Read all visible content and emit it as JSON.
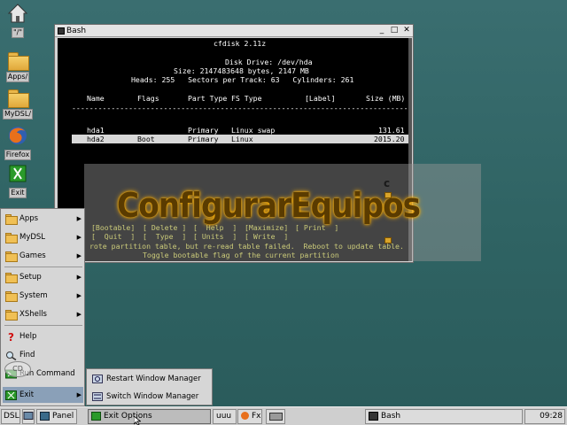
{
  "desktop": {
    "icons": [
      {
        "label": "\"/\"",
        "icon": "home-icon"
      },
      {
        "label": "Apps/",
        "icon": "folder-icon"
      },
      {
        "label": "MyDSL/",
        "icon": "folder-icon"
      },
      {
        "label": "Firefox",
        "icon": "firefox-icon"
      },
      {
        "label": "Exit",
        "icon": "exit-icon"
      }
    ]
  },
  "window": {
    "title": "Bash",
    "buttons": {
      "minimize": "_",
      "maximize": "□",
      "close": "✕"
    }
  },
  "cfdisk": {
    "title": "cfdisk 2.11z",
    "disk_drive": "Disk Drive: /dev/hda",
    "size_line": "Size: 2147483648 bytes, 2147 MB",
    "geometry": "Heads: 255   Sectors per Track: 63   Cylinders: 261",
    "columns": [
      "Name",
      "Flags",
      "Part Type",
      "FS Type",
      "[Label]",
      "Size (MB)"
    ],
    "rows": [
      {
        "name": "hda1",
        "flags": "",
        "part_type": "Primary",
        "fs_type": "Linux swap",
        "label": "",
        "size": "131.61"
      },
      {
        "name": "hda2",
        "flags": "Boot",
        "part_type": "Primary",
        "fs_type": "Linux",
        "label": "",
        "size": "2015.20"
      }
    ],
    "menu_row1": [
      "[Bootable]",
      "[ Delete ]",
      "[  Help  ]",
      "[Maximize]",
      "[ Print  ]"
    ],
    "menu_row2": [
      "[  Quit  ]",
      "[  Type  ]",
      "[ Units  ]",
      "[ Write  ]"
    ],
    "message": "rote partition table, but re-read table failed.  Reboot to update table.",
    "help_text": "Toggle bootable flag of the current partition"
  },
  "watermark": {
    "text": "ConfigurarEquipos",
    "letter": "c"
  },
  "start_menu": {
    "items": [
      {
        "label": "Apps",
        "icon": "folder-icon",
        "submenu": true
      },
      {
        "label": "MyDSL",
        "icon": "folder-icon",
        "submenu": true
      },
      {
        "label": "Games",
        "icon": "folder-icon",
        "submenu": true
      },
      {
        "label": "Setup",
        "icon": "folder-icon",
        "submenu": true
      },
      {
        "label": "System",
        "icon": "folder-icon",
        "submenu": true
      },
      {
        "label": "XShells",
        "icon": "folder-icon",
        "submenu": true
      },
      {
        "label": "Help",
        "icon": "help-icon",
        "submenu": false
      },
      {
        "label": "Find",
        "icon": "find-icon",
        "submenu": false
      },
      {
        "label": "Run Command",
        "icon": "run-icon",
        "submenu": false
      },
      {
        "label": "Exit",
        "icon": "exit-icon",
        "submenu": true
      }
    ],
    "arrow": "▶",
    "cd_badge": "CD"
  },
  "exit_submenu": {
    "items": [
      {
        "label": "Restart Window Manager",
        "icon": "restart-icon"
      },
      {
        "label": "Switch Window Manager",
        "icon": "switch-icon"
      }
    ]
  },
  "taskbar": {
    "start": "DSL",
    "panel": "Panel",
    "exit_options": "Exit Options",
    "uuu": "uuu",
    "fx": "Fx",
    "bash": "Bash",
    "clock": "09:28 AM"
  },
  "colors": {
    "desktop": "#2f6363",
    "menu_bg": "#d6d6d6",
    "menu_selected": "#8aa0b8",
    "terminal_bg": "#000000",
    "terminal_yellow": "#f0f060",
    "watermark_glow": "#ffb000"
  }
}
